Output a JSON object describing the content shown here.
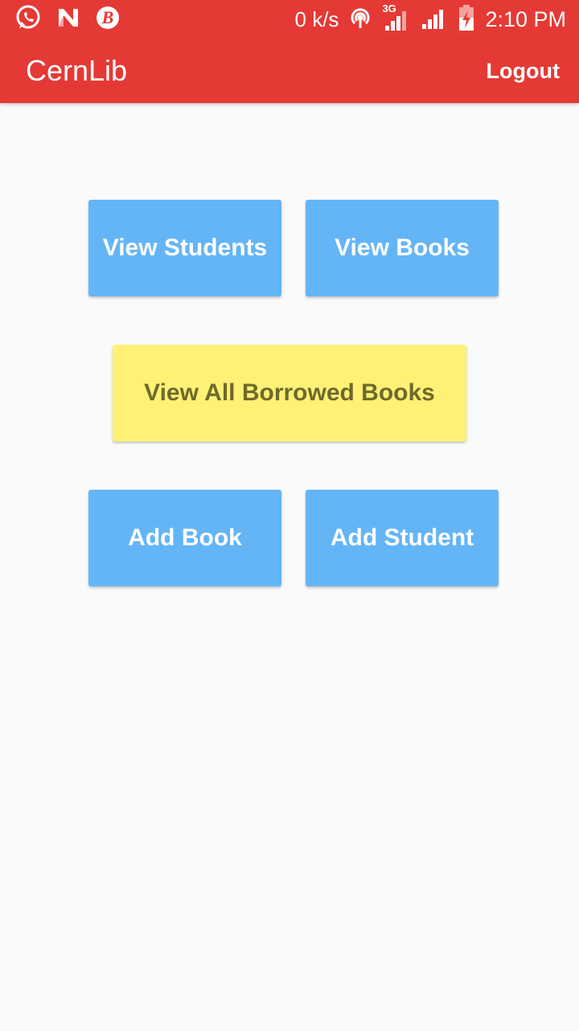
{
  "status_bar": {
    "icons_left": [
      "whatsapp-icon",
      "n-notification-icon",
      "b-notification-icon"
    ],
    "speed": "0 k/s",
    "network_label": "3G",
    "time": "2:10 PM"
  },
  "app_bar": {
    "title": "CernLib",
    "logout_label": "Logout"
  },
  "buttons": {
    "view_students": "View Students",
    "view_books": "View Books",
    "view_all_borrowed": "View All Borrowed Books",
    "add_book": "Add Book",
    "add_student": "Add Student"
  },
  "colors": {
    "primary": "#e53935",
    "button_blue": "#64b5f6",
    "button_yellow": "#fff176",
    "button_yellow_text": "#6f6a2a",
    "background": "#fafafa"
  }
}
